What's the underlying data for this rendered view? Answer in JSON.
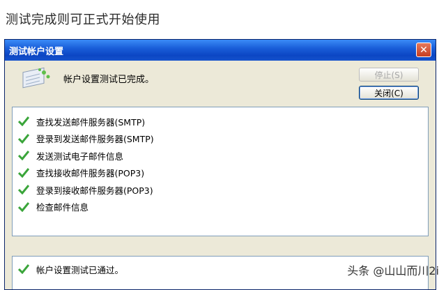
{
  "caption": "测试完成则可正式开始使用",
  "dialog": {
    "title": "测试帐户设置",
    "close_glyph": "✕",
    "status_message": "帐户设置测试已完成。",
    "buttons": {
      "stop": "停止(S)",
      "close": "关闭(C)"
    }
  },
  "tasks": [
    {
      "label": "查找发送邮件服务器(SMTP)",
      "status": "done"
    },
    {
      "label": "登录到发送邮件服务器(SMTP)",
      "status": "done"
    },
    {
      "label": "发送测试电子邮件信息",
      "status": "done"
    },
    {
      "label": "查找接收邮件服务器(POP3)",
      "status": "done"
    },
    {
      "label": "登录到接收邮件服务器(POP3)",
      "status": "done"
    },
    {
      "label": "检查邮件信息",
      "status": "done"
    }
  ],
  "result": {
    "label": "帐户设置测试已通过。",
    "status": "done"
  },
  "watermark": "头条 @山山而川2i",
  "colors": {
    "check": "#3aa53a",
    "titlebar": "#0c46c4"
  }
}
